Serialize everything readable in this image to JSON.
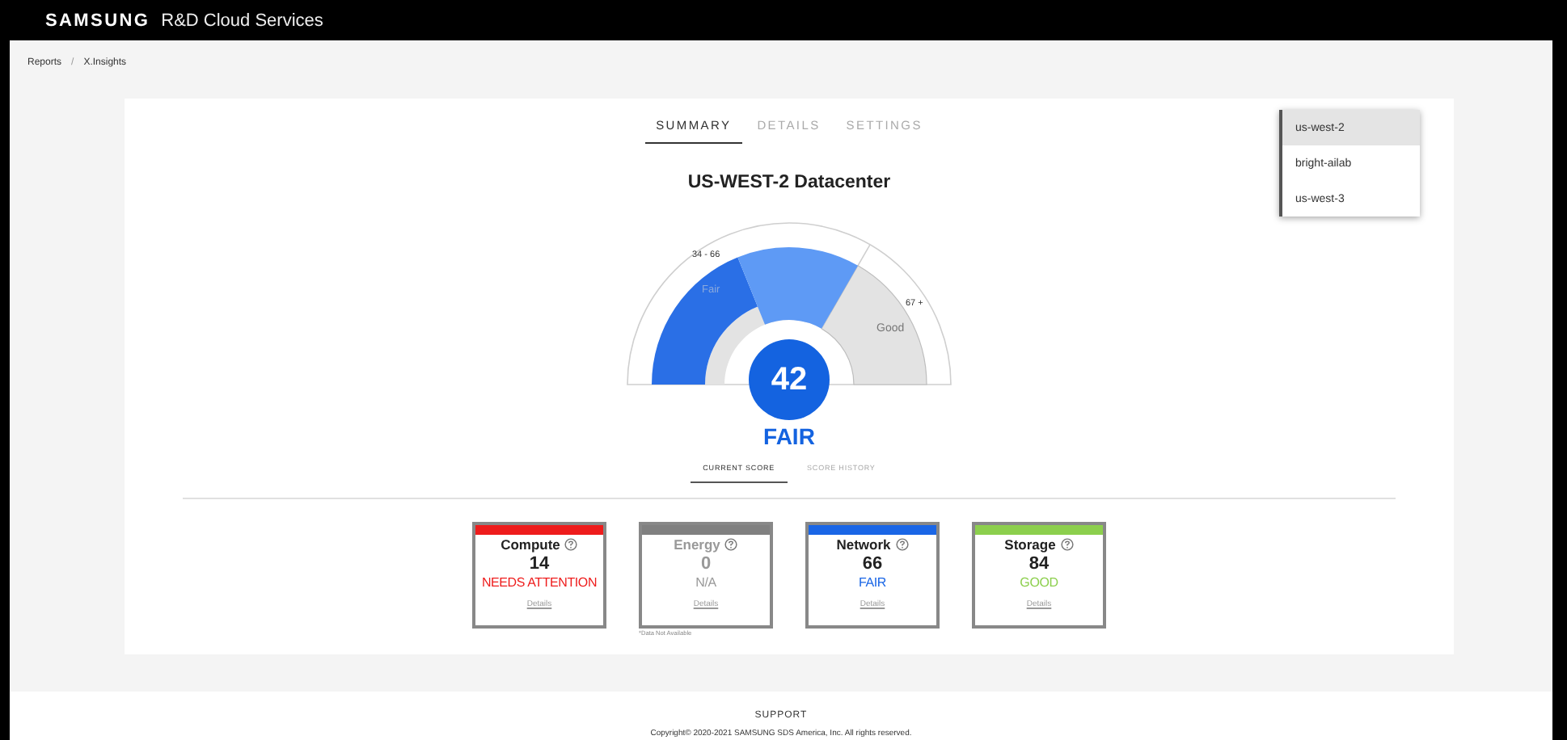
{
  "header": {
    "brand": "SAMSUNG",
    "title": "R&D Cloud Services"
  },
  "breadcrumb": {
    "items": [
      "Reports",
      "X.Insights"
    ],
    "separator": "/"
  },
  "tabs": [
    {
      "label": "SUMMARY",
      "selected": true
    },
    {
      "label": "DETAILS",
      "selected": false
    },
    {
      "label": "SETTINGS",
      "selected": false
    }
  ],
  "datacenter_menu": [
    {
      "label": "us-west-2",
      "selected": true
    },
    {
      "label": "bright-ailab",
      "selected": false
    },
    {
      "label": "us-west-3",
      "selected": false
    }
  ],
  "heading": "US-WEST-2 Datacenter",
  "gauge": {
    "range_label": "34 - 66",
    "high_label": "67 +",
    "fair_label": "Fair",
    "good_label": "Good",
    "score": "42",
    "rating": "FAIR"
  },
  "score_tabs": [
    {
      "label": "CURRENT SCORE",
      "selected": true
    },
    {
      "label": "SCORE HISTORY",
      "selected": false
    }
  ],
  "cards": [
    {
      "title": "Compute",
      "score": "14",
      "status": "NEEDS ATTENTION",
      "color": "#ee1c1c",
      "disabled": false,
      "link": "Details"
    },
    {
      "title": "Energy",
      "score": "0",
      "status": "N/A",
      "color": "#808080",
      "disabled": true,
      "link": "Details",
      "note": "*Data Not Available"
    },
    {
      "title": "Network",
      "score": "66",
      "status": "FAIR",
      "color": "#1a66e6",
      "disabled": false,
      "link": "Details"
    },
    {
      "title": "Storage",
      "score": "84",
      "status": "GOOD",
      "color": "#8ccf4d",
      "disabled": false,
      "link": "Details"
    }
  ],
  "footer": {
    "support": "SUPPORT",
    "copyright": "Copyright© 2020-2021 SAMSUNG SDS America, Inc. All rights reserved."
  }
}
